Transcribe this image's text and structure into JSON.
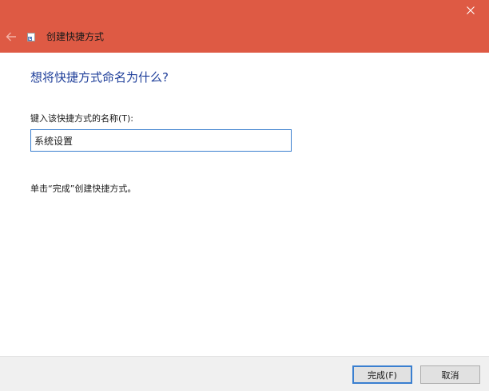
{
  "window": {
    "title": "创建快捷方式",
    "colors": {
      "titlebar": "#de5a44",
      "heading": "#1f3f9a",
      "input_border": "#3b7fce"
    }
  },
  "titlebar": {
    "close_icon": "close-icon",
    "back_icon": "back-arrow-icon"
  },
  "main": {
    "heading": "想将快捷方式命名为什么?",
    "name_label": "键入该快捷方式的名称(T):",
    "name_value": "系统设置",
    "hint": "单击“完成”创建快捷方式。"
  },
  "footer": {
    "finish_label": "完成(F)",
    "cancel_label": "取消"
  }
}
